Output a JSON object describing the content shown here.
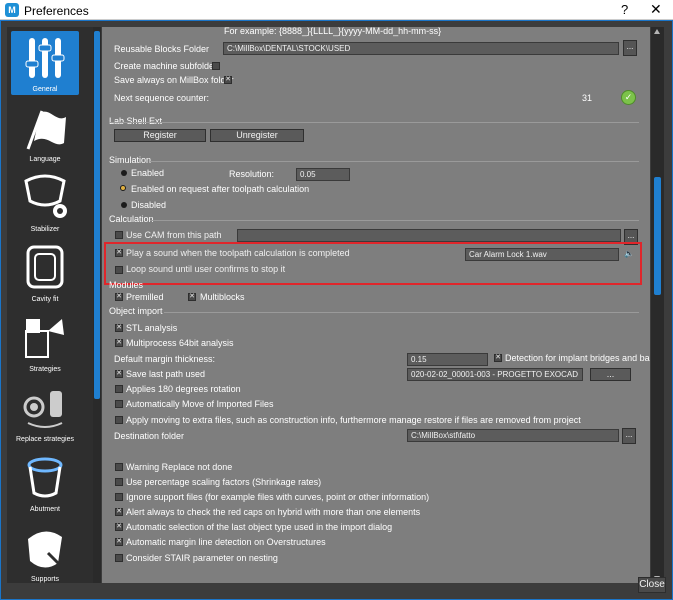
{
  "window": {
    "title": "Preferences",
    "help": "?",
    "close": "✕"
  },
  "sidebar": {
    "items": [
      {
        "label": "General",
        "icon": "sliders-icon"
      },
      {
        "label": "Language",
        "icon": "flag-icon"
      },
      {
        "label": "Stabilizer",
        "icon": "denture-gear-icon"
      },
      {
        "label": "Cavity fit",
        "icon": "cavity-icon"
      },
      {
        "label": "Strategies",
        "icon": "strategies-icon"
      },
      {
        "label": "Replace strategies",
        "icon": "replace-strategies-icon"
      },
      {
        "label": "Abutment",
        "icon": "abutment-icon"
      },
      {
        "label": "Supports",
        "icon": "supports-icon"
      }
    ]
  },
  "content": {
    "example_text": "For example: {8888_}{LLLL_}{yyyy-MM-dd_hh-mm-ss}",
    "reusable_blocks_label": "Reusable Blocks Folder",
    "reusable_blocks_value": "C:\\MillBox\\DENTAL\\STOCK\\USED",
    "create_machine_subfolder": "Create machine subfolder",
    "save_always_millbox": "Save always on MillBox folder",
    "next_sequence_label": "Next sequence counter:",
    "next_sequence_value": "31",
    "lab_shell_ext": "Lab Shell Ext",
    "register": "Register",
    "unregister": "Unregister",
    "simulation": "Simulation",
    "sim_enabled": "Enabled",
    "resolution_label": "Resolution:",
    "resolution_value": "0.05",
    "sim_on_request": "Enabled on request after toolpath calculation",
    "sim_disabled": "Disabled",
    "calculation": "Calculation",
    "use_cam": "Use CAM from this path",
    "play_sound": "Play a sound when the toolpath calculation is completed",
    "sound_file": "Car Alarm Lock 1.wav",
    "loop_sound": "Loop sound until user confirms to stop it",
    "modules": "Modules",
    "premilled": "Premilled",
    "multiblocks": "Multiblocks",
    "object_import": "Object import",
    "stl_analysis": "STL analysis",
    "multiprocess": "Multiprocess 64bit analysis",
    "default_margin_label": "Default margin thickness:",
    "default_margin_value": "0.15",
    "detection_implant": "Detection for implant bridges and ba",
    "save_last_path": "Save last path used",
    "last_path_value": "020-02-02_00001-003 - PROGETTO EXOCAD",
    "applies_180": "Applies 180 degrees rotation",
    "auto_move": "Automatically Move of Imported Files",
    "apply_moving": "Apply moving to extra files, such as construction info, furthermore manage restore if files are removed from project",
    "destination_label": "Destination folder",
    "destination_value": "C:\\MillBox\\stl\\fatto",
    "warning_replace": "Warning Replace not done",
    "use_percentage": "Use percentage scaling factors (Shrinkage rates)",
    "ignore_support": "Ignore support files (for example files with curves, point or other information)",
    "alert_red_caps": "Alert always to check the red caps on hybrid with more than one elements",
    "auto_selection": "Automatic selection of the last object type used in the import dialog",
    "auto_margin": "Automatic margin line detection on Overstructures",
    "consider_stair": "Consider STAIR parameter on nesting",
    "dots": "..."
  },
  "footer": {
    "close": "Close"
  },
  "colors": {
    "accent": "#1f7fd0",
    "highlight": "#e0262b",
    "panel": "#7e7e7e"
  }
}
